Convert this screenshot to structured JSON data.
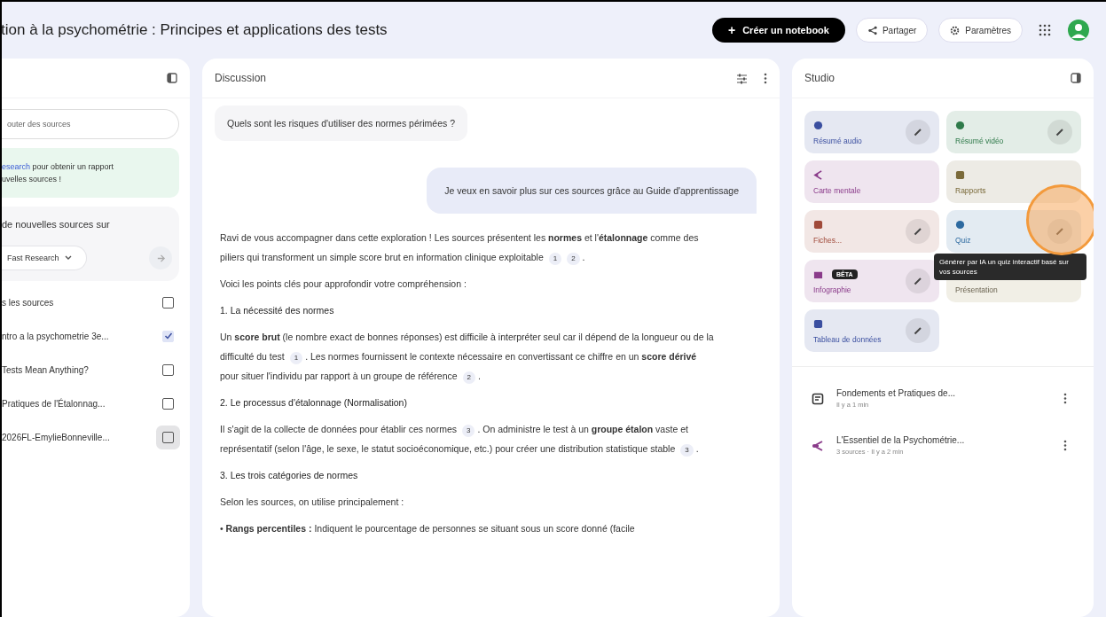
{
  "header": {
    "title": "tion à la psychométrie : Principes et applications des tests",
    "create_button": "Créer un notebook",
    "create_icon": "+",
    "share_button": "Partager",
    "settings_button": "Paramètres"
  },
  "sources": {
    "add_field": {
      "placeholder": "outer des sources"
    },
    "banner": {
      "link": "esearch",
      "lines": [
        "pour obtenir un rapport",
        "uvelles sources !"
      ]
    },
    "research": {
      "title": "de nouvelles sources sur",
      "mode": "Fast Research"
    },
    "select_all": {
      "label": "s les sources",
      "checked": false
    },
    "items": [
      {
        "label": "ntro a la psychometrie 3e...",
        "checked": true
      },
      {
        "label": "Tests Mean Anything?",
        "checked": false
      },
      {
        "label": "Pratiques de l'Étalonnag...",
        "checked": false
      },
      {
        "label": "2026FL-EmylieBonneville...",
        "checked": false
      }
    ]
  },
  "chat": {
    "title": "Discussion",
    "messages": [
      {
        "kind": "question",
        "text": "Quels sont les risques d'utiliser des normes périmées ?"
      },
      {
        "kind": "user",
        "text": "Je veux en savoir plus sur ces sources grâce au Guide d'apprentissage"
      }
    ],
    "answer": [
      {
        "kind": "paragraph",
        "parts": [
          {
            "kind": "text",
            "text": "Ravi de vous accompagner dans cette exploration ! Les sources présentent les **normes** et l'**étalonnage** comme des piliers qui transforment un simple score brut en information clinique exploitable "
          },
          {
            "kind": "cite",
            "text": "1"
          },
          {
            "kind": "cite",
            "text": "2"
          },
          {
            "kind": "text",
            "text": "."
          }
        ]
      },
      {
        "kind": "paragraph",
        "parts": [
          {
            "kind": "text",
            "text": "Voici les points clés pour approfondir votre compréhension :"
          }
        ]
      },
      {
        "kind": "heading",
        "parts": [
          {
            "kind": "text",
            "text": "1. La nécessité des normes"
          }
        ]
      },
      {
        "kind": "paragraph",
        "parts": [
          {
            "kind": "text",
            "text": "Un **score brut** (le nombre exact de bonnes réponses) est difficile à interpréter seul car il dépend de la longueur ou de la difficulté du test "
          },
          {
            "kind": "cite",
            "text": "1"
          },
          {
            "kind": "text",
            "text": ". Les normes fournissent le contexte nécessaire en convertissant ce chiffre en un **score dérivé** pour situer l'individu par rapport à un groupe de référence "
          },
          {
            "kind": "cite",
            "text": "2"
          },
          {
            "kind": "text",
            "text": "."
          }
        ]
      },
      {
        "kind": "heading",
        "parts": [
          {
            "kind": "text",
            "text": "2. Le processus d'étalonnage (Normalisation)"
          }
        ]
      },
      {
        "kind": "paragraph",
        "parts": [
          {
            "kind": "text",
            "text": "Il s'agit de la collecte de données pour établir ces normes "
          },
          {
            "kind": "cite",
            "text": "3"
          },
          {
            "kind": "text",
            "text": ". On administre le test à un **groupe étalon** vaste et représentatif (selon l'âge, le sexe, le statut socioéconomique, etc.) pour créer une distribution statistique stable "
          },
          {
            "kind": "cite",
            "text": "3"
          },
          {
            "kind": "text",
            "text": "."
          }
        ]
      },
      {
        "kind": "heading",
        "parts": [
          {
            "kind": "text",
            "text": "3. Les trois catégories de normes"
          }
        ]
      },
      {
        "kind": "paragraph",
        "parts": [
          {
            "kind": "text",
            "text": "Selon les sources, on utilise principalement :"
          }
        ]
      },
      {
        "kind": "paragraph",
        "parts": [
          {
            "kind": "text",
            "text": "• **Rangs percentiles :** Indiquent le pourcentage de personnes se situant sous un score donné (facile"
          }
        ]
      }
    ]
  },
  "studio": {
    "title": "Studio",
    "tools": [
      {
        "kind": "audio",
        "label": "Résumé audio",
        "color": "#3b4fa0",
        "edit": true
      },
      {
        "kind": "video",
        "label": "Résumé vidéo",
        "color": "#2f7a4a",
        "edit": true
      },
      {
        "kind": "mindmap",
        "label": "Carte mentale",
        "color": "#8a3b8a",
        "edit": false
      },
      {
        "kind": "report",
        "label": "Rapports",
        "color": "#7a6a3a",
        "edit": false
      },
      {
        "kind": "cards",
        "label": "Fiches...",
        "color": "#a04a3a",
        "edit": true
      },
      {
        "kind": "quiz",
        "label": "Quiz",
        "color": "#2d6aa0",
        "edit": true
      },
      {
        "kind": "infographic",
        "label": "Infographie",
        "color": "#8a3b8a",
        "edit": true,
        "badge": "BÊTA"
      },
      {
        "kind": "slides",
        "label": "Présentation",
        "edit": false
      },
      {
        "kind": "table",
        "label": "Tableau de données",
        "color": "#3b4fa0",
        "edit": true
      }
    ],
    "tooltip": "Générer par IA un quiz interactif basé sur vos sources",
    "notes": [
      {
        "kind": "note",
        "title": "Fondements et Pratiques de...",
        "meta": "Il y a 1 min"
      },
      {
        "kind": "mindmap",
        "title": "L'Essentiel de la Psychométrie...",
        "meta": "3 sources · Il y a 2 min"
      }
    ]
  }
}
